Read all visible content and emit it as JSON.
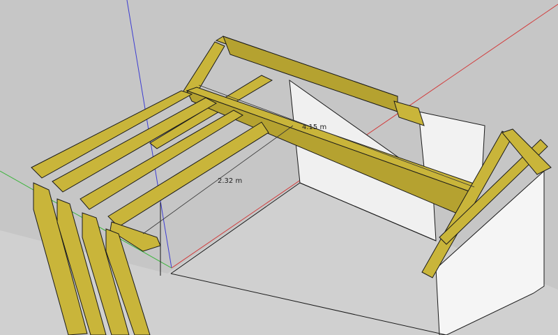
{
  "viewport": {
    "sky_color": "#c6c6c6",
    "ground_color": "#d2d2d2",
    "wall_color": "#f2f2f2",
    "wood_color": "#c9b53a",
    "wood_dark": "#a6952c",
    "edge_color": "#1a1a1a"
  },
  "axes": {
    "red": "#d23c3c",
    "green": "#3cb43c",
    "blue": "#3c3cd2"
  },
  "dimensions": [
    {
      "label": "4.15 m"
    },
    {
      "label": "2.32 m"
    }
  ]
}
